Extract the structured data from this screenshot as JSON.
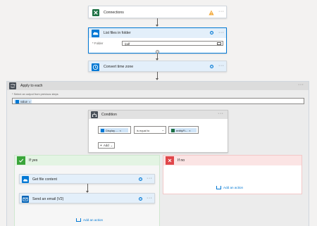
{
  "colors": {
    "canvas": "#f3f2f1",
    "accent": "#0078d4",
    "yes_green": "#3aa53a",
    "no_red": "#e0464a",
    "warning": "#f2a93b",
    "excel_green": "#1e7145",
    "outlook_blue": "#0364b8"
  },
  "connections": {
    "title": "Connections",
    "icon": "excel-icon",
    "status_icon": "warning-icon"
  },
  "list_files": {
    "title": "List files in folder",
    "icon": "onedrive-cloud-icon",
    "folder_label": "* Folder",
    "folder_value": "/pdf",
    "folder_picker_icon": "folder-icon"
  },
  "convert_time": {
    "title": "Convert time zone",
    "icon": "clock-icon"
  },
  "apply_each": {
    "title": "Apply to each",
    "icon": "loop-icon",
    "select_label": "* Select an output from previous steps",
    "token": "value"
  },
  "condition": {
    "title": "Condition",
    "icon": "condition-icon",
    "left_token": "Display ...",
    "operator": "is equal to",
    "right_token": "entityFi...",
    "add_label": "Add"
  },
  "if_yes": {
    "title": "If yes",
    "get_file": "Get file content",
    "send_email": "Send an email (V2)",
    "add_action": "Add an action"
  },
  "if_no": {
    "title": "If no",
    "add_action": "Add an action"
  }
}
